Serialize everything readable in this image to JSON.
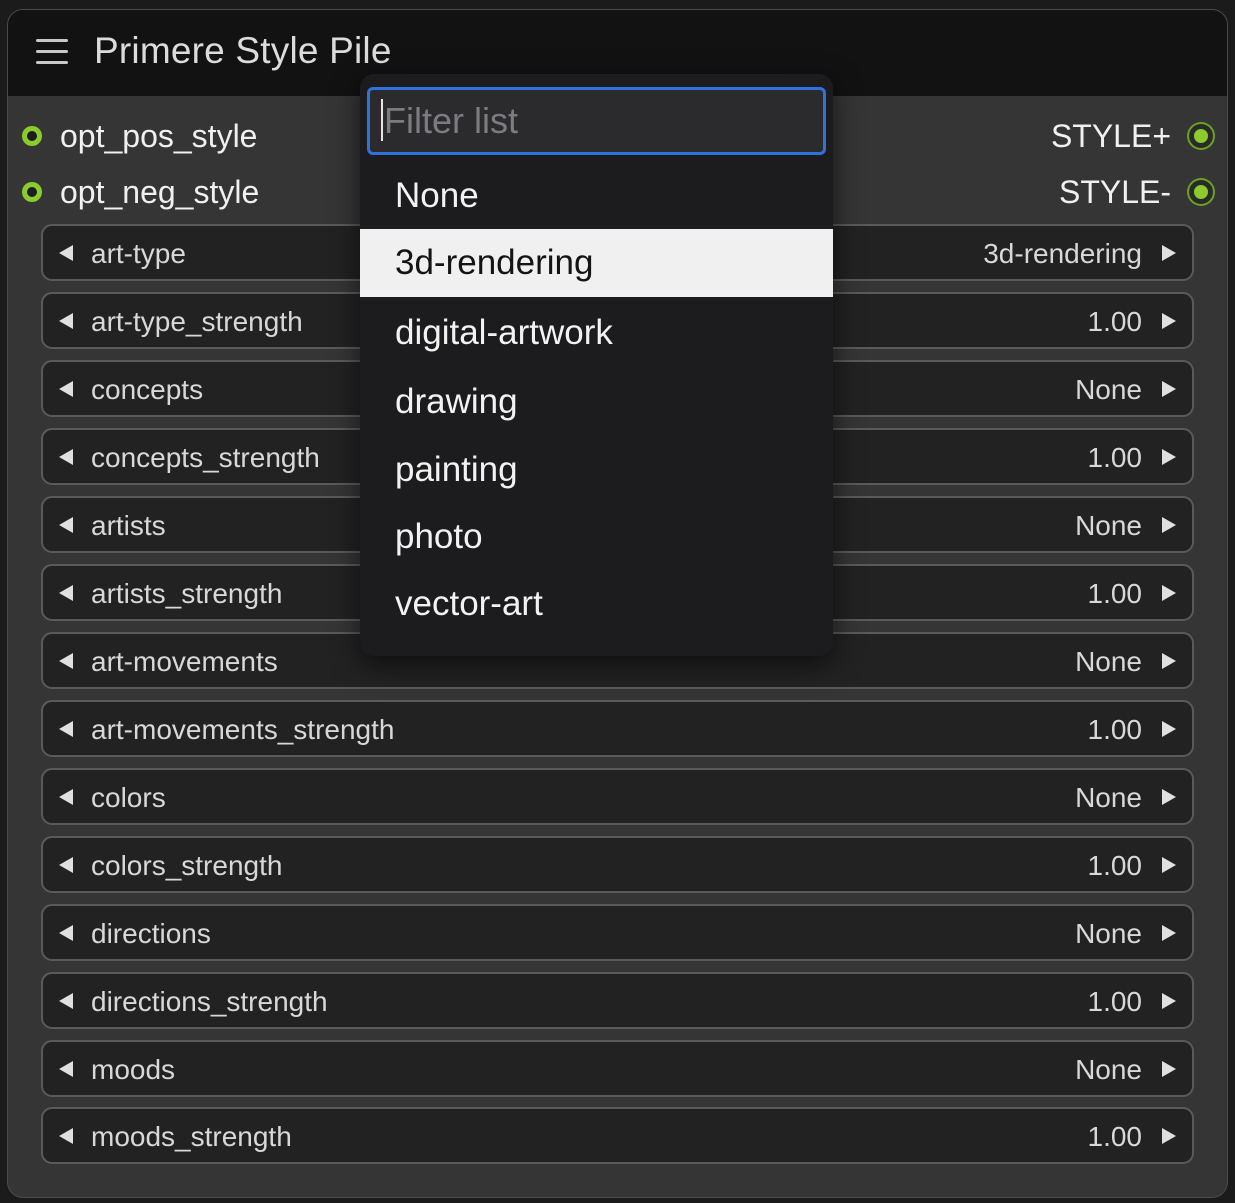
{
  "node": {
    "title": "Primere Style Pile"
  },
  "inputs": [
    {
      "label": "opt_pos_style"
    },
    {
      "label": "opt_neg_style"
    }
  ],
  "outputs": [
    {
      "label": "STYLE+"
    },
    {
      "label": "STYLE-"
    }
  ],
  "widgets": [
    {
      "name": "art-type",
      "value": "3d-rendering"
    },
    {
      "name": "art-type_strength",
      "value": "1.00"
    },
    {
      "name": "concepts",
      "value": "None"
    },
    {
      "name": "concepts_strength",
      "value": "1.00"
    },
    {
      "name": "artists",
      "value": "None"
    },
    {
      "name": "artists_strength",
      "value": "1.00"
    },
    {
      "name": "art-movements",
      "value": "None"
    },
    {
      "name": "art-movements_strength",
      "value": "1.00"
    },
    {
      "name": "colors",
      "value": "None"
    },
    {
      "name": "colors_strength",
      "value": "1.00"
    },
    {
      "name": "directions",
      "value": "None"
    },
    {
      "name": "directions_strength",
      "value": "1.00"
    },
    {
      "name": "moods",
      "value": "None"
    },
    {
      "name": "moods_strength",
      "value": "1.00"
    }
  ],
  "dropdown": {
    "filter_placeholder": "Filter list",
    "filter_value": "",
    "options": [
      "None",
      "3d-rendering",
      "digital-artwork",
      "drawing",
      "painting",
      "photo",
      "vector-art"
    ],
    "highlighted": "3d-rendering"
  },
  "colors": {
    "slot_connected": "#8bcb2e",
    "filter_border": "#2f72d9",
    "highlight_bg": "#f0f0f0"
  }
}
